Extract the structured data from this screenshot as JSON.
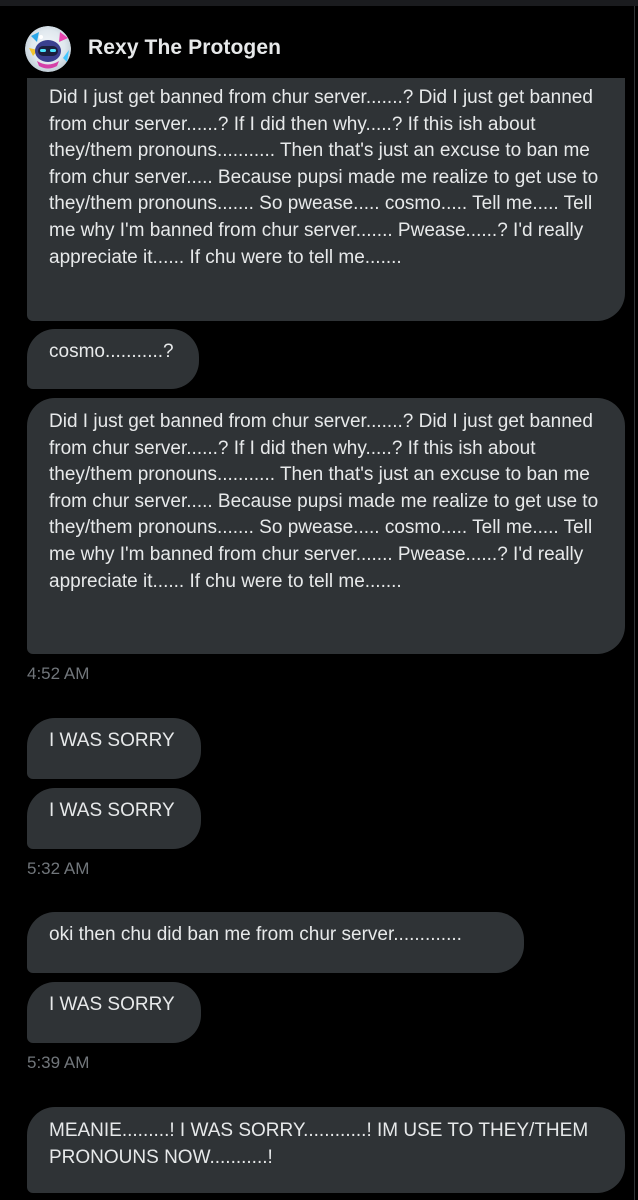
{
  "conversation": {
    "contact_name": "Rexy The Protogen",
    "avatar_icon": "protogen-avatar-icon"
  },
  "colors": {
    "background": "#000000",
    "bubble": "#2f3336",
    "text": "#e7e9ea",
    "timestamp": "#71767b"
  },
  "messages": [
    {
      "text": "Did I just get banned from chur server.......? Did I just get banned from chur server......? If I did then why.....? If this ish about they/them pronouns........... Then that's just an excuse to ban me from chur server..... Because pupsi made me realize to get use to they/them pronouns....... So pwease..... cosmo..... Tell me..... Tell me why I'm banned from chur server....... Pwease......? I'd really appreciate it...... If chu were to tell me......."
    },
    {
      "text": "cosmo...........?"
    },
    {
      "text": "Did I just get banned from chur server.......? Did I just get banned from chur server......? If I did then why.....? If this ish about they/them pronouns........... Then that's just an excuse to ban me from chur server..... Because pupsi made me realize to get use to they/them pronouns....... So pwease..... cosmo..... Tell me..... Tell me why I'm banned from chur server....... Pwease......? I'd really appreciate it...... If chu were to tell me......."
    },
    {
      "text": "I WAS SORRY"
    },
    {
      "text": "I WAS SORRY"
    },
    {
      "text": "oki then chu did ban me from chur server............."
    },
    {
      "text": "I WAS SORRY"
    },
    {
      "text": "MEANIE.........! I WAS SORRY............! IM USE TO THEY/THEM PRONOUNS NOW...........!"
    }
  ],
  "timestamps": [
    "4:52 AM",
    "5:32 AM",
    "5:39 AM"
  ]
}
